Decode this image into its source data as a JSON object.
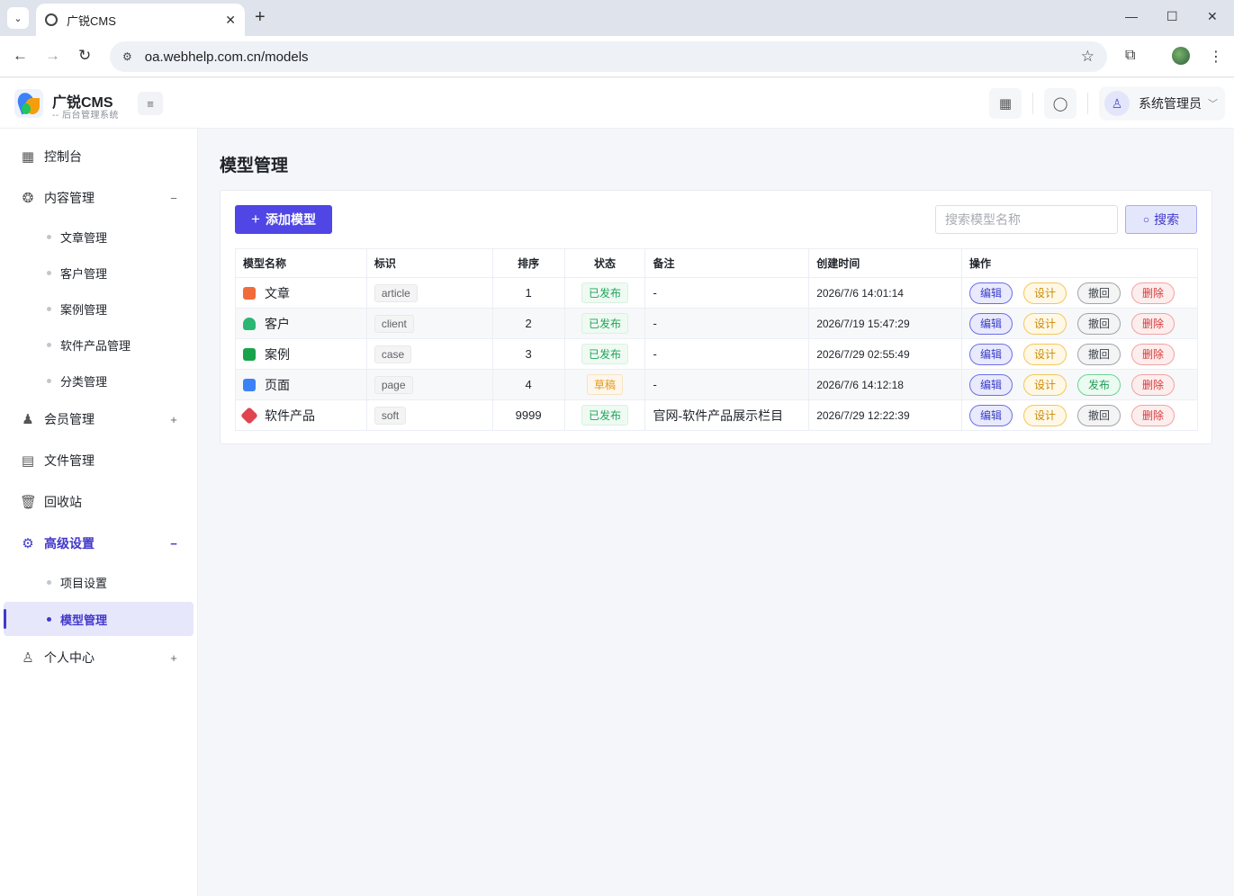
{
  "browser": {
    "tab_title": "广锐CMS",
    "url": "oa.webhelp.com.cn/models"
  },
  "header": {
    "brand_name": "广锐CMS",
    "brand_sub": "-- 后台管理系统",
    "user_name": "系统管理员"
  },
  "sidebar": {
    "items": [
      {
        "label": "控制台",
        "icon": "dashboard-icon"
      },
      {
        "label": "内容管理",
        "icon": "content-icon",
        "toggle": "−"
      },
      {
        "label": "文章管理"
      },
      {
        "label": "客户管理"
      },
      {
        "label": "案例管理"
      },
      {
        "label": "软件产品管理"
      },
      {
        "label": "分类管理"
      },
      {
        "label": "会员管理",
        "icon": "member-icon",
        "toggle": "+"
      },
      {
        "label": "文件管理",
        "icon": "file-icon"
      },
      {
        "label": "回收站",
        "icon": "trash-icon"
      },
      {
        "label": "高级设置",
        "icon": "gear-icon",
        "toggle": "−"
      },
      {
        "label": "项目设置"
      },
      {
        "label": "模型管理"
      },
      {
        "label": "个人中心",
        "icon": "user-center-icon",
        "toggle": "+"
      }
    ]
  },
  "main": {
    "page_title": "模型管理",
    "add_button": "添加模型",
    "search_placeholder": "搜索模型名称",
    "search_button": "搜索",
    "table": {
      "headers": [
        "模型名称",
        "标识",
        "排序",
        "状态",
        "备注",
        "创建时间",
        "操作"
      ],
      "rows": [
        {
          "name": "文章",
          "code": "article",
          "order": "1",
          "status": "已发布",
          "remark": "-",
          "created": "2026/7/6 14:01:14",
          "ops": [
            "编辑",
            "设计",
            "撤回",
            "删除"
          ],
          "icon_color": "#f26b3a"
        },
        {
          "name": "客户",
          "code": "client",
          "order": "2",
          "status": "已发布",
          "remark": "-",
          "created": "2026/7/19 15:47:29",
          "ops": [
            "编辑",
            "设计",
            "撤回",
            "删除"
          ],
          "icon_color": "#2bb673"
        },
        {
          "name": "案例",
          "code": "case",
          "order": "3",
          "status": "已发布",
          "remark": "-",
          "created": "2026/7/29 02:55:49",
          "ops": [
            "编辑",
            "设计",
            "撤回",
            "删除"
          ],
          "icon_color": "#1aa34a"
        },
        {
          "name": "页面",
          "code": "page",
          "order": "4",
          "status": "草稿",
          "remark": "-",
          "created": "2026/7/6 14:12:18",
          "ops": [
            "编辑",
            "设计",
            "发布",
            "删除"
          ],
          "icon_color": "#3b82f6"
        },
        {
          "name": "软件产品",
          "code": "soft",
          "order": "9999",
          "status": "已发布",
          "remark": "官网-软件产品展示栏目",
          "created": "2026/7/29 12:22:39",
          "ops": [
            "编辑",
            "设计",
            "撤回",
            "删除"
          ],
          "icon_color": "#e0454f"
        }
      ]
    }
  },
  "colors": {
    "accent": "#4f46e5",
    "published": "#22a35a",
    "draft": "#e39a1a",
    "delete": "#d63a3a"
  }
}
